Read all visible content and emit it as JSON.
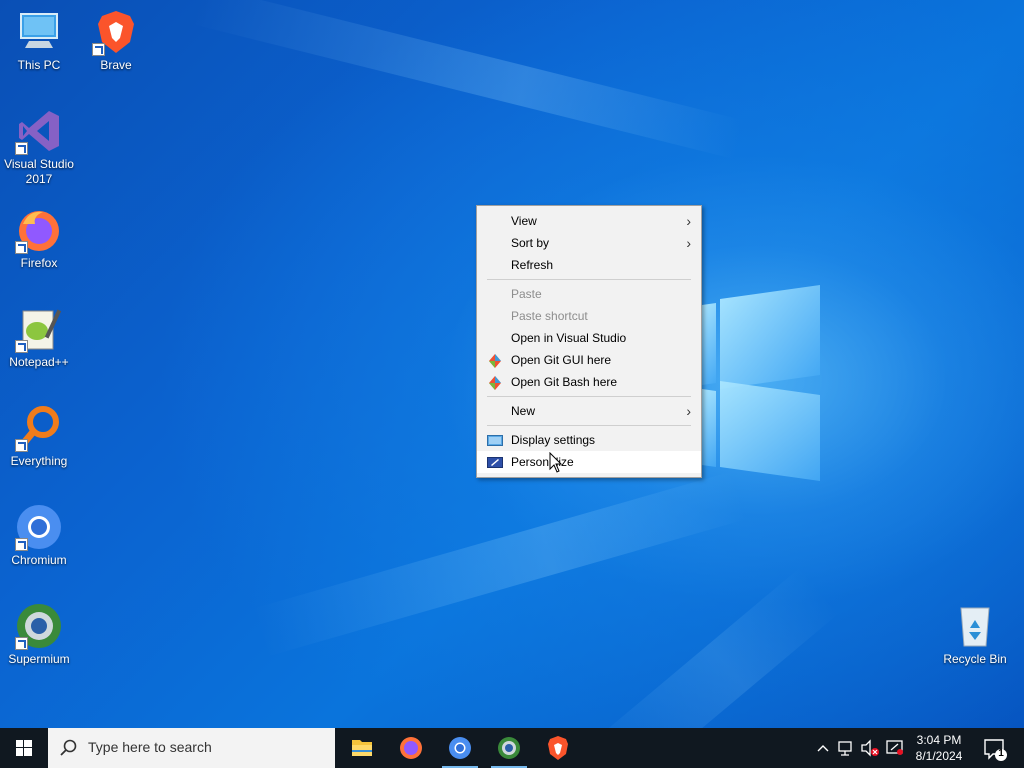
{
  "desktop": {
    "icons": [
      {
        "label": "This PC"
      },
      {
        "label": "Brave"
      },
      {
        "label": "Visual Studio 2017"
      },
      {
        "label": "Firefox"
      },
      {
        "label": "Notepad++"
      },
      {
        "label": "Everything"
      },
      {
        "label": "Chromium"
      },
      {
        "label": "Supermium"
      },
      {
        "label": "Recycle Bin"
      }
    ]
  },
  "context_menu": {
    "items": [
      {
        "label": "View",
        "submenu": true
      },
      {
        "label": "Sort by",
        "submenu": true
      },
      {
        "label": "Refresh"
      },
      {
        "label": "Paste",
        "disabled": true
      },
      {
        "label": "Paste shortcut",
        "disabled": true
      },
      {
        "label": "Open in Visual Studio"
      },
      {
        "label": "Open Git GUI here",
        "icon": "git-icon"
      },
      {
        "label": "Open Git Bash here",
        "icon": "git-icon"
      },
      {
        "label": "New",
        "submenu": true
      },
      {
        "label": "Display settings",
        "icon": "display-icon"
      },
      {
        "label": "Personalize",
        "icon": "personalize-icon",
        "hovered": true
      }
    ],
    "arrow_glyph": "›"
  },
  "taskbar": {
    "search_placeholder": "Type here to search",
    "pinned": [
      "file-explorer-icon",
      "firefox-icon",
      "chromium-icon",
      "supermium-icon",
      "brave-icon"
    ],
    "clock": {
      "time": "3:04 PM",
      "date": "8/1/2024"
    },
    "notification_count": "1"
  },
  "colors": {
    "desktop_blue": "#0b63d0",
    "taskbar": "#101820",
    "menu_bg": "#f2f2f2",
    "accent": "#0078d7"
  }
}
